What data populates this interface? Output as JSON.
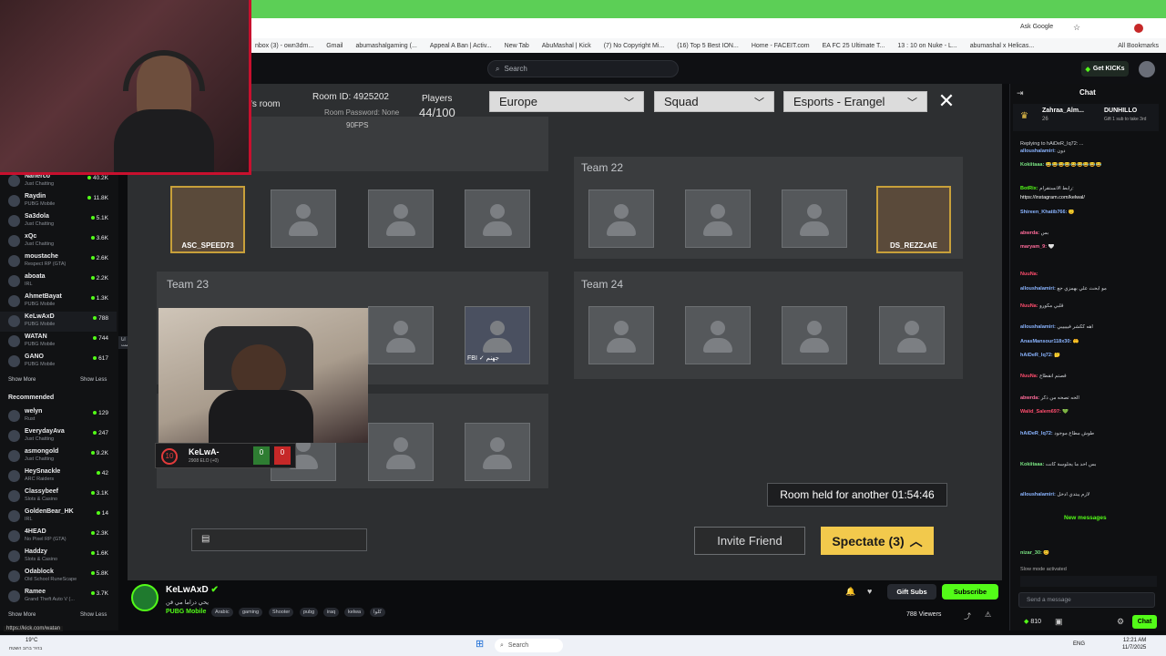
{
  "browser": {
    "ask_google": "Ask Google",
    "bookmarks": [
      "nbox (3) - own3dm...",
      "Gmail",
      "abumashalgaming (...",
      "Appeal A Ban | Activ...",
      "New Tab",
      "AbuMashal | Kick",
      "(7) No Copyright Mi...",
      "(16) Top 5 Best ION...",
      "Home - FACEIT.com",
      "EA FC 25 Ultimate T...",
      "13 : 10 on Nuke - L...",
      "abumashal x Helicas..."
    ],
    "all_bookmarks": "All Bookmarks",
    "status_url": "https://kick.com/watan"
  },
  "header": {
    "search_placeholder": "Search",
    "get_kicks": "Get KICKs"
  },
  "sidebar": {
    "following": [
      {
        "name": "Naherco",
        "category": "Just Chatting",
        "viewers": "40.2K"
      },
      {
        "name": "Raydin",
        "category": "PUBG Mobile",
        "viewers": "11.8K"
      },
      {
        "name": "Sa3dola",
        "category": "Just Chatting",
        "viewers": "5.1K"
      },
      {
        "name": "xQc",
        "category": "Just Chatting",
        "viewers": "3.6K"
      },
      {
        "name": "moustache",
        "category": "Respect RP (GTA)",
        "viewers": "2.6K"
      },
      {
        "name": "aboata",
        "category": "IRL",
        "viewers": "2.2K"
      },
      {
        "name": "AhmetBayat",
        "category": "PUBG Mobile",
        "viewers": "1.3K"
      },
      {
        "name": "KeLwAxD",
        "category": "PUBG Mobile",
        "viewers": "788"
      },
      {
        "name": "WATAN",
        "category": "PUBG Mobile",
        "viewers": "744"
      },
      {
        "name": "GANO",
        "category": "PUBG Mobile",
        "viewers": "617"
      }
    ],
    "show_more": "Show More",
    "show_less": "Show Less",
    "tooltip": "انا جكشت",
    "recommended_heading": "Recommended",
    "recommended": [
      {
        "name": "welyn",
        "category": "Rust",
        "viewers": "129"
      },
      {
        "name": "EverydayAva",
        "category": "Just Chatting",
        "viewers": "247"
      },
      {
        "name": "asmongold",
        "category": "Just Chatting",
        "viewers": "9.2K"
      },
      {
        "name": "HeySnackle",
        "category": "ARC Raiders",
        "viewers": "42"
      },
      {
        "name": "Classybeef",
        "category": "Slots & Casino",
        "viewers": "3.1K"
      },
      {
        "name": "GoldenBear_HK",
        "category": "IRL",
        "viewers": "14"
      },
      {
        "name": "4HEAD",
        "category": "No Pixel RP (GTA)",
        "viewers": "2.3K"
      },
      {
        "name": "Haddzy",
        "category": "Slots & Casino",
        "viewers": "1.6K"
      },
      {
        "name": "Odablock",
        "category": "Old School RuneScape",
        "viewers": "5.8K"
      },
      {
        "name": "Ramee",
        "category": "Grand Theft Auto V (...",
        "viewers": "3.7K"
      }
    ],
    "show_more_2": "Show More",
    "show_less_2": "Show Less"
  },
  "game": {
    "room_prefix": "'s room",
    "room_id": "Room ID: 4925202",
    "room_password": "Room Password: None",
    "players_label": "Players",
    "players_count": "44/100",
    "fps": "90FPS",
    "region": "Europe",
    "mode": "Squad",
    "map": "Esports - Erangel",
    "teams": [
      {
        "label": "Team 22"
      },
      {
        "label": "Team 23"
      },
      {
        "label": "Team 24"
      }
    ],
    "player_asc": "ASC_SPEED73",
    "player_ds": "DS_REZZxAE",
    "player_fbi": "FBI ✓ جهنم",
    "room_held": "Room held for another 01:54:46",
    "invite_friend": "Invite Friend",
    "spectate": "Spectate (3)"
  },
  "player_card": {
    "name": "KeLwA-",
    "elo": "2908 ELO (+0)",
    "level": "10",
    "wins": "0",
    "losses": "0"
  },
  "chat": {
    "title": "Chat",
    "pinned_user": "Zahraa_Alm...",
    "pinned_count": "26",
    "gifter": "DUNHILLO",
    "gifter_text": "Gift 1 sub to take 3rd",
    "lines": [
      {
        "user": "",
        "text": "Replying to hAiDeR_Iq72: ..."
      },
      {
        "user": "alloushalamiri:",
        "text": "دون"
      },
      {
        "user": "Kokiitaaa:",
        "text": "😂😂😂😂😂😂😂😂😂"
      },
      {
        "user": "BotRix:",
        "text": "رابط الانستقرام:"
      },
      {
        "user": "",
        "text": "https://instagram.com/kelwal/"
      },
      {
        "user": "Shireen_Khatib766:",
        "text": "🙂"
      },
      {
        "user": "abwrda:",
        "text": "بس"
      },
      {
        "user": "maryam_9:",
        "text": "🤍"
      },
      {
        "user": "NuuNa:",
        "text": ""
      },
      {
        "user": "alloushalamiri:",
        "text": "مو ابحث علي بهمزي جع"
      },
      {
        "user": "NuuNa:",
        "text": "قلبي مكورو"
      },
      {
        "user": "alloushalamiri:",
        "text": "اهه ككشر فيييييي"
      },
      {
        "user": "AnasMansour118x30:",
        "text": "🤲"
      },
      {
        "user": "hAiDeR_Iq72:",
        "text": "🤔"
      },
      {
        "user": "NuuNa:",
        "text": "قصتم انقطاع"
      },
      {
        "user": "abwrda:",
        "text": "الحه تصحه من ذكر"
      },
      {
        "user": "Walid_Salem697:",
        "text": "💚"
      },
      {
        "user": "hAiDeR_Iq72:",
        "text": "طوش مطاع موجود"
      },
      {
        "user": "Kokiitaaa:",
        "text": "بس احد ما يجلوسة كانت"
      },
      {
        "user": "alloushalamiri:",
        "text": "لازم يبتدي ادخل"
      }
    ],
    "new_messages": "New messages",
    "slow_mode": "Slow mode activated",
    "send_placeholder": "Send a message",
    "points": "810",
    "chat_button": "Chat",
    "last_line_user": "nizar_30:",
    "last_line_text": "😊"
  },
  "channel": {
    "name": "KeLwAxD",
    "title": "يحي دراما مي قن",
    "category": "PUBG Mobile",
    "tags": [
      "Arabic",
      "gaming",
      "Shooter",
      "pubg",
      "iraq",
      "kelwa",
      "كلوا"
    ],
    "gift_subs": "Gift Subs",
    "subscribe": "Subscribe",
    "viewers": "788 Viewers"
  },
  "taskbar": {
    "weather": "19°C",
    "weather_sub": "בהיר ברוב השטח",
    "search": "Search",
    "lang": "ENG",
    "time": "12:21 AM",
    "date": "11/7/2025"
  },
  "colors": {
    "kick_green": "#53fc18",
    "spectate_yellow": "#f2c94c",
    "webcam_border": "#c8102e"
  }
}
